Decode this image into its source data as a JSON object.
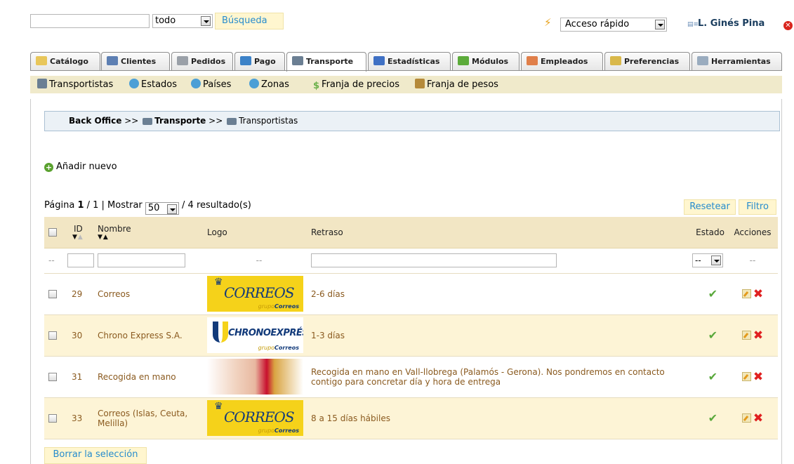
{
  "topbar": {
    "search_value": "",
    "search_scope": "todo",
    "search_button": "Búsqueda",
    "quick_access": "Acceso rápido",
    "user_name": "L. Ginés Pina"
  },
  "tabs": [
    {
      "label": "Catálogo",
      "icon": "folder-icon",
      "color": "#e8c65a"
    },
    {
      "label": "Clientes",
      "icon": "user-icon",
      "color": "#5d7fb3"
    },
    {
      "label": "Pedidos",
      "icon": "cart-icon",
      "color": "#9aa0a8"
    },
    {
      "label": "Pago",
      "icon": "payment-icon",
      "color": "#3c82c8"
    },
    {
      "label": "Transporte",
      "icon": "truck-icon",
      "color": "#6b7f93"
    },
    {
      "label": "Estadísticas",
      "icon": "chart-icon",
      "color": "#3f70c4"
    },
    {
      "label": "Módulos",
      "icon": "puzzle-icon",
      "color": "#5cab3a"
    },
    {
      "label": "Empleados",
      "icon": "employees-icon",
      "color": "#e07f4a"
    },
    {
      "label": "Preferencias",
      "icon": "preferences-icon",
      "color": "#d9b84a"
    },
    {
      "label": "Herramientas",
      "icon": "wrench-icon",
      "color": "#9aacbf"
    }
  ],
  "active_tab": "Transporte",
  "subnav": [
    {
      "label": "Transportistas",
      "icon": "truck-icon",
      "color": "#6b7f93"
    },
    {
      "label": "Estados",
      "icon": "globe-icon",
      "color": "#4c9fd6"
    },
    {
      "label": "Países",
      "icon": "globe-icon",
      "color": "#4c9fd6"
    },
    {
      "label": "Zonas",
      "icon": "globe-icon",
      "color": "#4c9fd6"
    },
    {
      "label": "Franja de precios",
      "icon": "dollar-icon",
      "color": "#6bb04a"
    },
    {
      "label": "Franja de pesos",
      "icon": "weight-icon",
      "color": "#b58a3a"
    }
  ],
  "breadcrumb": {
    "root": "Back Office",
    "sep1": ">>",
    "section": "Transporte",
    "sep2": ">>",
    "page": "Transportistas"
  },
  "add_new": "Añadir nuevo",
  "pagination": {
    "label_page": "Página",
    "current": "1",
    "of": "/ 1 | Mostrar",
    "per_page": "50",
    "results": "/ 4 resultado(s)"
  },
  "reset_button": "Resetear",
  "filter_button": "Filtro",
  "columns": {
    "id": "ID",
    "name": "Nombre",
    "logo": "Logo",
    "delay": "Retraso",
    "status": "Estado",
    "actions": "Acciones"
  },
  "filter_row": {
    "placeholder_dash": "--",
    "logo_dash": "--",
    "status_value": "--",
    "actions_dash": "--"
  },
  "rows": [
    {
      "id": "29",
      "name": "Correos",
      "logo": "correos",
      "delay": "2-6 días",
      "active": true
    },
    {
      "id": "30",
      "name": "Chrono Express S.A.",
      "logo": "chrono",
      "delay": "1-3 días",
      "active": true
    },
    {
      "id": "31",
      "name": "Recogida en mano",
      "logo": "hands",
      "delay": "Recogida en mano en Vall-llobrega (Palamós - Gerona). Nos pondremos en contacto contigo para concretar día y hora de entrega",
      "active": true
    },
    {
      "id": "33",
      "name": "Correos (Islas, Ceuta, Melilla)",
      "logo": "correos",
      "delay": "8 a 15 días hábiles",
      "active": true
    }
  ],
  "logos": {
    "correos_main": "CORREOS",
    "correos_sub_1": "grupo",
    "correos_sub_2": "Correos",
    "chrono_main": "CHRONOEXPRÉS",
    "chrono_sub_1": "grupo",
    "chrono_sub_2": "Correos"
  },
  "clear_selection": "Borrar la selección",
  "colors": {
    "link": "#268ccd",
    "button_bg": "#fff6cf",
    "header_bg": "#f2e6c4",
    "alt_row": "#fdf4d6",
    "row_text": "#8a5a1f",
    "check": "#59a83b",
    "delete": "#e02020"
  }
}
